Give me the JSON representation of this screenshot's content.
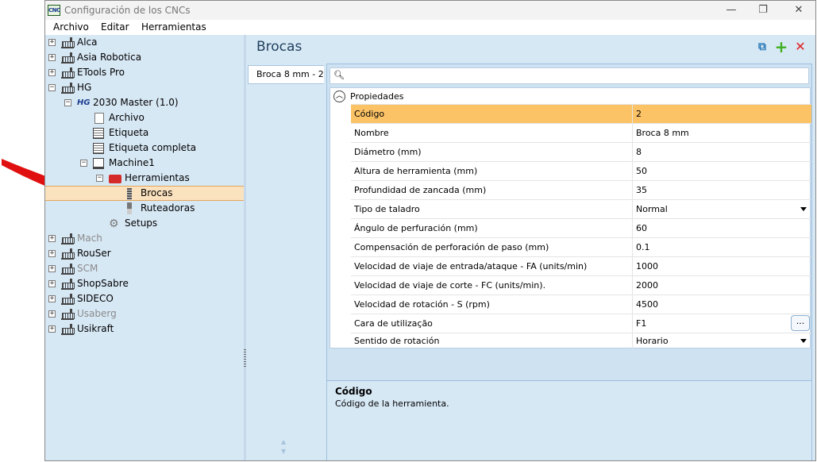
{
  "window": {
    "title": "Configuración de los CNCs",
    "app_icon_text": "CNC"
  },
  "menu": [
    "Archivo",
    "Editar",
    "Herramientas"
  ],
  "tree": [
    {
      "label": "Alca",
      "disabled": false
    },
    {
      "label": "Asia Robotica",
      "disabled": false
    },
    {
      "label": "ETools Pro",
      "disabled": false
    },
    {
      "label": "HG",
      "disabled": false
    },
    {
      "label": "2030 Master (1.0)",
      "disabled": false
    },
    {
      "label": "Archivo",
      "disabled": false
    },
    {
      "label": "Etiqueta",
      "disabled": false
    },
    {
      "label": "Etiqueta completa",
      "disabled": false
    },
    {
      "label": "Machine1",
      "disabled": false
    },
    {
      "label": "Herramientas",
      "disabled": false
    },
    {
      "label": "Brocas",
      "disabled": false,
      "selected": true
    },
    {
      "label": "Ruteadoras",
      "disabled": false
    },
    {
      "label": "Setups",
      "disabled": false
    },
    {
      "label": "Mach",
      "disabled": true
    },
    {
      "label": "RouSer",
      "disabled": false
    },
    {
      "label": "SCM",
      "disabled": true
    },
    {
      "label": "ShopSabre",
      "disabled": false
    },
    {
      "label": "SIDECO",
      "disabled": false
    },
    {
      "label": "Usaberg",
      "disabled": true
    },
    {
      "label": "Usikraft",
      "disabled": false
    }
  ],
  "panel": {
    "title": "Brocas",
    "tab_label": "Broca 8 mm - 2"
  },
  "grid": {
    "category": "Propiedades",
    "rows": [
      {
        "name": "Código",
        "value": "2"
      },
      {
        "name": "Nombre",
        "value": "Broca 8 mm"
      },
      {
        "name": "Diámetro (mm)",
        "value": "8"
      },
      {
        "name": "Altura de herramienta (mm)",
        "value": "50"
      },
      {
        "name": "Profundidad de zancada (mm)",
        "value": "35"
      },
      {
        "name": "Tipo de taladro",
        "value": "Normal"
      },
      {
        "name": "Ángulo de perfuración (mm)",
        "value": "60"
      },
      {
        "name": "Compensación de perforación de paso (mm)",
        "value": "0.1"
      },
      {
        "name": "Velocidad de viaje de entrada/ataque - FA (units/min)",
        "value": "1000"
      },
      {
        "name": "Velocidad de viaje de corte - FC (units/min).",
        "value": "2000"
      },
      {
        "name": "Velocidad de rotación - S (rpm)",
        "value": "4500"
      },
      {
        "name": "Cara de utilização",
        "value": "F1"
      },
      {
        "name": "Sentido de rotación",
        "value": "Horario"
      }
    ],
    "ellipsis_label": "..."
  },
  "description": {
    "title": "Código",
    "text": "Código de la herramienta."
  },
  "icons": {
    "copy": "copy-icon",
    "add": "add-icon",
    "delete": "delete-icon",
    "accent_add": "#3cb01e",
    "accent_delete": "#e02020",
    "accent_copy": "#2a7ab8",
    "annotation_arrow": "#e01010"
  }
}
